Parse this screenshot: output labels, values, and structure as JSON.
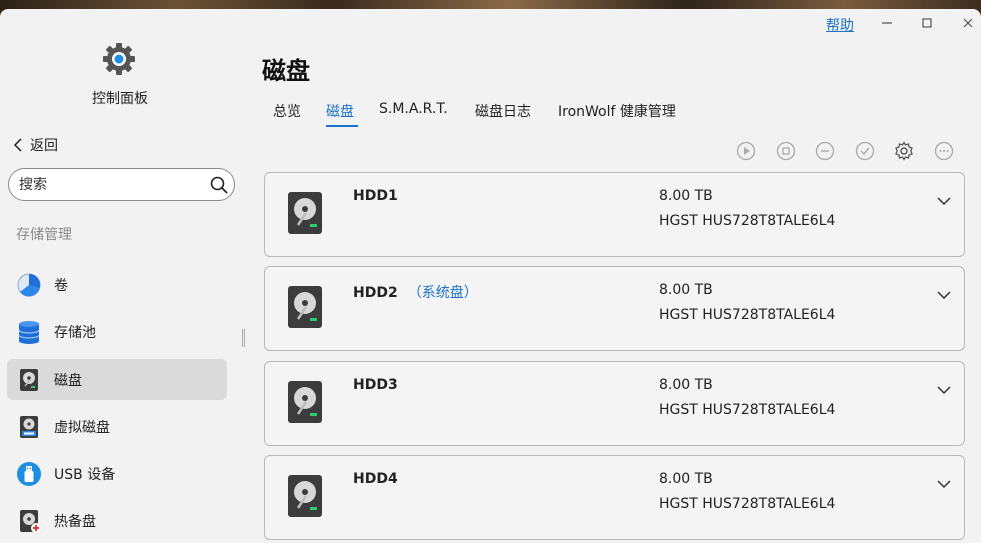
{
  "window": {
    "help_label": "帮助",
    "controls": [
      "minimize",
      "maximize",
      "close"
    ]
  },
  "sidebar": {
    "app_title": "控制面板",
    "back_label": "返回",
    "search_placeholder": "搜索",
    "section_label": "存储管理",
    "items": [
      {
        "label": "卷",
        "icon": "pie-chart-icon",
        "active": false
      },
      {
        "label": "存储池",
        "icon": "database-icon",
        "active": false
      },
      {
        "label": "磁盘",
        "icon": "hdd-icon",
        "active": true
      },
      {
        "label": "虚拟磁盘",
        "icon": "virtual-disk-icon",
        "active": false
      },
      {
        "label": "USB 设备",
        "icon": "usb-icon",
        "active": false
      },
      {
        "label": "热备盘",
        "icon": "hot-spare-icon",
        "active": false
      }
    ]
  },
  "main": {
    "title": "磁盘",
    "tabs": [
      {
        "label": "总览",
        "active": false
      },
      {
        "label": "磁盘",
        "active": true
      },
      {
        "label": "S.M.A.R.T.",
        "active": false
      },
      {
        "label": "磁盘日志",
        "active": false
      },
      {
        "label": "IronWolf 健康管理",
        "active": false
      }
    ],
    "toolbar": [
      "play-icon",
      "stop-icon",
      "minus-icon",
      "check-icon",
      "settings-icon",
      "more-icon"
    ],
    "disks": [
      {
        "name": "HDD1",
        "tag": "",
        "size": "8.00 TB",
        "model": "HGST HUS728T8TALE6L4"
      },
      {
        "name": "HDD2",
        "tag": "（系统盘）",
        "size": "8.00 TB",
        "model": "HGST HUS728T8TALE6L4"
      },
      {
        "name": "HDD3",
        "tag": "",
        "size": "8.00 TB",
        "model": "HGST HUS728T8TALE6L4"
      },
      {
        "name": "HDD4",
        "tag": "",
        "size": "8.00 TB",
        "model": "HGST HUS728T8TALE6L4"
      }
    ]
  },
  "colors": {
    "accent": "#1a73c9",
    "window_bg": "#f2f2f2",
    "active_item_bg": "#dadada"
  }
}
